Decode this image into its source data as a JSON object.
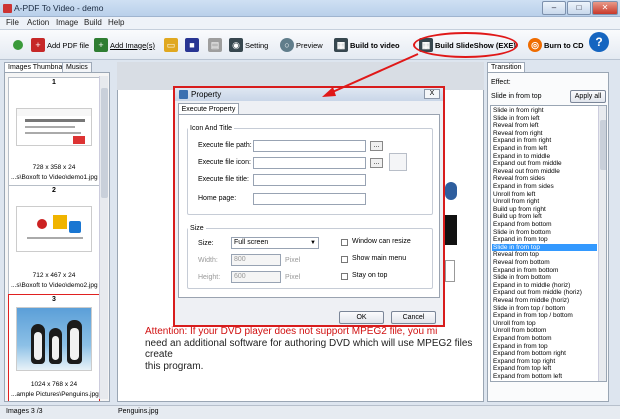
{
  "window": {
    "title": "A-PDF To Video - demo",
    "minimize": "–",
    "maximize": "□",
    "close": "✕"
  },
  "menu": [
    "File",
    "Action",
    "Image",
    "Build",
    "Help"
  ],
  "toolbar": {
    "add_pdf": "Add PDF file",
    "add_image": "Add Image(s)",
    "setting": "Setting",
    "preview": "Preview",
    "build_video": "Build to video",
    "build_slideshow": "Build SlideShow (EXE)",
    "burn_cd": "Burn to CD",
    "help": "?"
  },
  "left_tabs": [
    "Images Thumbnail",
    "Musics"
  ],
  "thumbnails": [
    {
      "num": "1",
      "dims": "728 x 358 x 24",
      "path": "...s\\Boxoft to Video\\demo1.jpg"
    },
    {
      "num": "2",
      "dims": "712 x 467 x 24",
      "path": "...s\\Boxoft to Video\\demo2.jpg"
    },
    {
      "num": "3",
      "dims": "1024 x 768 x 24",
      "path": "...ample Pictures\\Penguins.jpg"
    }
  ],
  "attention": {
    "prefix": "Attention: If your DVD player does not support MPEG2 file, you mi",
    "line2": "need an additional software for authoring DVD which will use MPEG2 files create",
    "line3": "this program."
  },
  "dialog": {
    "title": "Property",
    "close": "X",
    "tab": "Execute Property",
    "group_icon": "Icon And Title",
    "exe_path_label": "Execute file path:",
    "exe_icon_label": "Execute file icon:",
    "exe_title_label": "Execute file title:",
    "home_label": "Home page:",
    "browse": "...",
    "group_size": "Size",
    "size_label": "Size:",
    "size_value": "Full screen",
    "width_label": "Width:",
    "width_value": "800",
    "height_label": "Height:",
    "height_value": "600",
    "pixel": "Pixel",
    "resize": "Window can resize",
    "main_menu": "Show main menu",
    "stay_top": "Stay on top",
    "ok": "OK",
    "cancel": "Cancel"
  },
  "right": {
    "tab": "Transition",
    "effect_label": "Effect:",
    "effect_current": "Slide in from top",
    "apply_all": "Apply all",
    "selected_index": 18,
    "items": [
      "Slide in from right",
      "Slide in from left",
      "Reveal from left",
      "Reveal from right",
      "Expand in from right",
      "Expand in from left",
      "Expand in to middle",
      "Expand out from middle",
      "Reveal out from middle",
      "Reveal from sides",
      "Expand in from sides",
      "Unroll from left",
      "Unroll from right",
      "Build up from right",
      "Build up from left",
      "Expand from bottom",
      "Slide in from bottom",
      "Expand in from top",
      "Slide in from top",
      "Reveal from top",
      "Reveal from bottom",
      "Expand in from bottom",
      "Slide in from bottom",
      "Expand in to middle (horiz)",
      "Expand out from middle (horiz)",
      "Reveal from middle (horiz)",
      "Slide in from top / bottom",
      "Expand in from top / bottom",
      "Unroll from top",
      "Unroll from bottom",
      "Expand from bottom",
      "Expand in from top",
      "Expand from bottom right",
      "Expand from top right",
      "Expand from top left",
      "Expand from bottom left"
    ]
  },
  "status": {
    "count": "Images 3 /3",
    "file": "Penguins.jpg"
  }
}
